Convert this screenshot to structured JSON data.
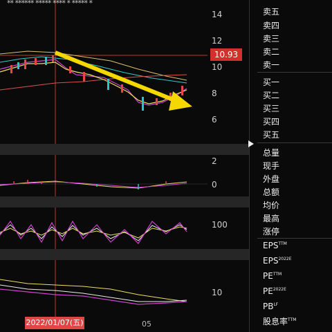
{
  "chart": {
    "stars": "**  ****** *****  ****  *  *****  *",
    "y_labels": [
      "14",
      "12",
      "10",
      "8",
      "6"
    ],
    "macd_labels": [
      "2",
      "0"
    ],
    "kdj_labels": [
      "100"
    ],
    "vol_labels": [
      "10"
    ],
    "current_price": "10.93",
    "crosshair_date": "2022/01/07(五)",
    "x_label": "05",
    "colors": {
      "up": "#e84545",
      "down": "#22c7c7",
      "arrow": "#f5d800",
      "crosshair": "#c0392b"
    }
  },
  "panel": {
    "sell_items": [
      "卖五",
      "卖四",
      "卖三",
      "卖二",
      "卖一"
    ],
    "buy_items": [
      "买一",
      "买二",
      "买三",
      "买四",
      "买五"
    ],
    "stats": [
      "总量",
      "现手",
      "外盘",
      "总额",
      "均价",
      "最高",
      "涨停"
    ],
    "eps": "EPS",
    "eps_sup": "TTM",
    "eps2": "EPS",
    "eps2_sup": "2022E",
    "pe": "PE",
    "pe_sup": "TTM",
    "pe2": "PE",
    "pe2_sup": "2022E",
    "pb": "PB",
    "pb_sup": "LF",
    "div": "股息率",
    "div_sup": "TTM",
    "expand_icon": "triangle-right-icon"
  }
}
